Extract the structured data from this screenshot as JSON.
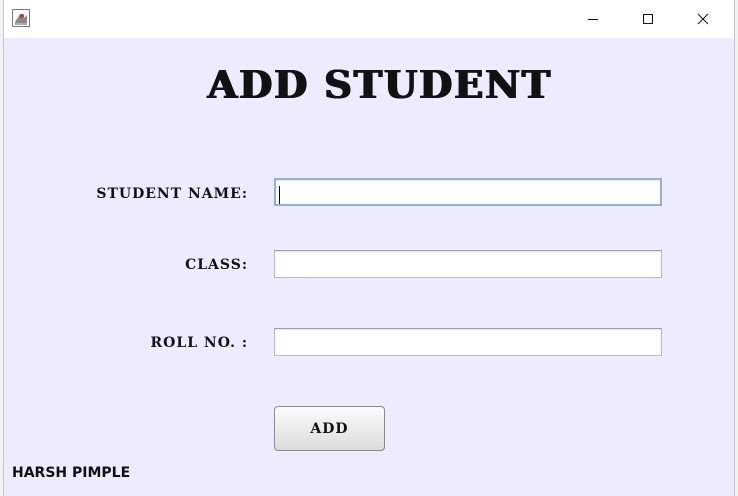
{
  "window": {
    "controls": {
      "minimize_icon": "minimize-icon",
      "maximize_icon": "maximize-icon",
      "close_icon": "close-icon"
    },
    "app_icon": "java-app-icon"
  },
  "form": {
    "heading": "ADD STUDENT",
    "fields": [
      {
        "label": "STUDENT NAME:",
        "value": ""
      },
      {
        "label": "CLASS:",
        "value": ""
      },
      {
        "label": "ROLL NO. :",
        "value": ""
      }
    ],
    "submit_label": "ADD"
  },
  "footer": {
    "author": "HARSH PIMPLE"
  },
  "colors": {
    "content_background": "#eeeaff",
    "focus_border": "#8fb2d6"
  }
}
